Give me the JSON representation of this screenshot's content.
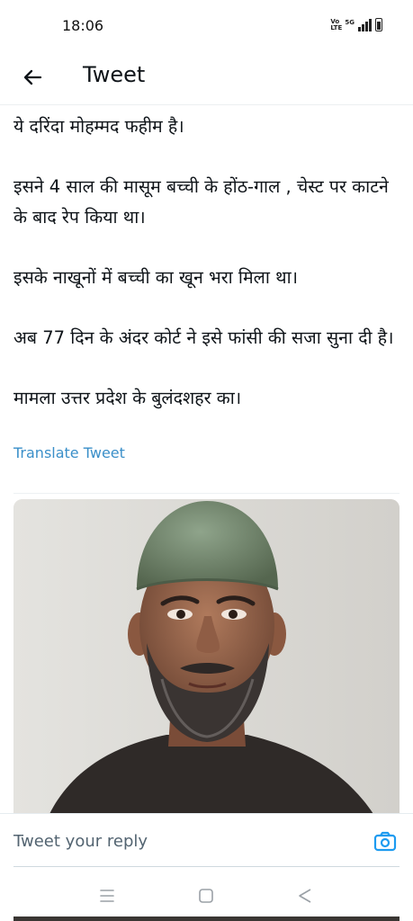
{
  "status_bar": {
    "time": "18:06",
    "network_label": "Vo LTE",
    "network_type": "5G"
  },
  "header": {
    "title": "Tweet"
  },
  "tweet": {
    "paragraphs": [
      "ये दरिंदा मोहम्मद फहीम है।",
      "इसने 4 साल की मासूम बच्ची के होंठ-गाल , चेस्ट पर काटने के बाद रेप किया था।",
      "इसके नाखूनों में बच्ची का खून भरा मिला था।",
      "अब 77 दिन के अंदर कोर्ट ने इसे फांसी की सजा सुना दी है।",
      "मामला उत्तर प्रदेश के बुलंदशहर का।"
    ],
    "translate_label": "Translate Tweet"
  },
  "reply": {
    "placeholder": "Tweet your reply"
  },
  "colors": {
    "link": "#3a8fc9",
    "accent": "#1d9bf0",
    "text": "#0f1419",
    "muted": "#536471"
  },
  "icons": {
    "back": "arrow-left-icon",
    "camera": "camera-icon",
    "recents": "menu-icon",
    "home": "square-icon",
    "back_nav": "triangle-back-icon"
  }
}
